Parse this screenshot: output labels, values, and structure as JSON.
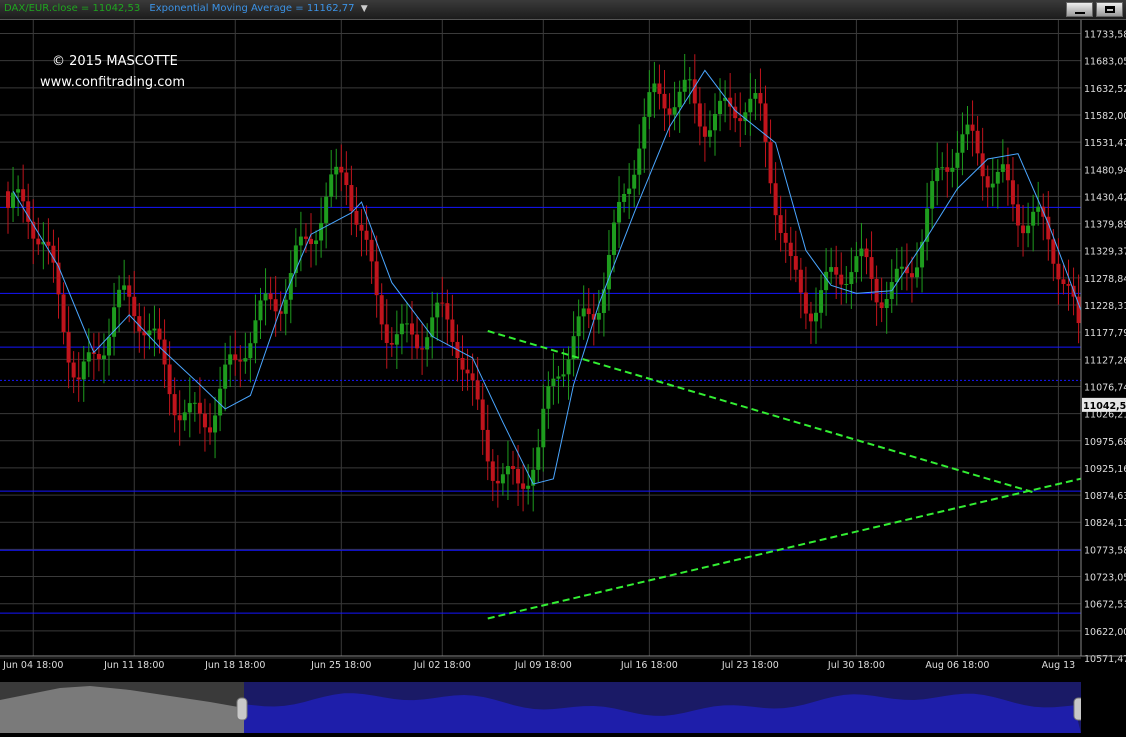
{
  "header": {
    "close_label": "DAX/EUR.close = 11042,53",
    "ema_label": "Exponential Moving Average = 11162,77",
    "dropdown_icon": "chevron-down-icon",
    "minimize_icon": "minimize-icon",
    "maximize_icon": "maximize-icon"
  },
  "watermark": {
    "copyright": "© 2015 MASCOTTE",
    "website": "www.confitrading.com"
  },
  "colors": {
    "background": "#000000",
    "bull": "#1e9c1e",
    "bear": "#c0141c",
    "ema": "#4aa6ff",
    "grid": "#3a3a3a",
    "levels": "#1414ff",
    "trendline": "#33ee33",
    "nav_left": "#7a7a7a",
    "nav_right": "#1e1eaa"
  },
  "chart_data": {
    "type": "candlestick",
    "y_ticks": [
      "11733,58",
      "11683,05",
      "11632,52",
      "11582,00",
      "11531,47",
      "11480,94",
      "11430,42",
      "11379,89",
      "11329,37",
      "11278,84",
      "11228,31",
      "11177,79",
      "11127,26",
      "11076,74",
      "11026,21",
      "10975,68",
      "10925,16",
      "10874,63",
      "10824,11",
      "10773,58",
      "10723,05",
      "10672,53",
      "10622,00",
      "10571,47"
    ],
    "x_ticks": [
      "Jun 04 18:00",
      "Jun 11 18:00",
      "Jun 18 18:00",
      "Jun 25 18:00",
      "Jul 02 18:00",
      "Jul 09 18:00",
      "Jul 16 18:00",
      "Jul 23 18:00",
      "Jul 30 18:00",
      "Aug 06 18:00",
      "Aug 13"
    ],
    "ylim": [
      10571.47,
      11755
    ],
    "last_price_label": "11042,53",
    "last_price": 11042.53,
    "horizontal_levels": [
      11410,
      11250,
      11150,
      10882,
      10772,
      10655
    ],
    "dotted_level": 11088,
    "trendlines": [
      {
        "from_index": 95,
        "from_value": 11180,
        "to_index": 203,
        "to_value": 10880
      },
      {
        "from_index": 95,
        "from_value": 10645,
        "to_index": 216,
        "to_value": 10913
      }
    ],
    "ema_series": [
      [
        1,
        11440
      ],
      [
        10,
        11300
      ],
      [
        17,
        11140
      ],
      [
        24,
        11210
      ],
      [
        30,
        11150
      ],
      [
        38,
        11080
      ],
      [
        43,
        11035
      ],
      [
        48,
        11060
      ],
      [
        55,
        11250
      ],
      [
        60,
        11360
      ],
      [
        68,
        11400
      ],
      [
        70,
        11420
      ],
      [
        76,
        11270
      ],
      [
        84,
        11170
      ],
      [
        92,
        11130
      ],
      [
        98,
        11010
      ],
      [
        104,
        10895
      ],
      [
        108,
        10905
      ],
      [
        112,
        11080
      ],
      [
        117,
        11230
      ],
      [
        124,
        11400
      ],
      [
        131,
        11560
      ],
      [
        138,
        11665
      ],
      [
        144,
        11590
      ],
      [
        152,
        11530
      ],
      [
        158,
        11330
      ],
      [
        163,
        11265
      ],
      [
        168,
        11250
      ],
      [
        175,
        11255
      ],
      [
        182,
        11355
      ],
      [
        188,
        11445
      ],
      [
        194,
        11500
      ],
      [
        200,
        11510
      ],
      [
        206,
        11380
      ],
      [
        215,
        11155
      ]
    ]
  },
  "navigator": {
    "handle_left_icon": "range-handle-icon",
    "handle_right_icon": "range-handle-icon"
  }
}
